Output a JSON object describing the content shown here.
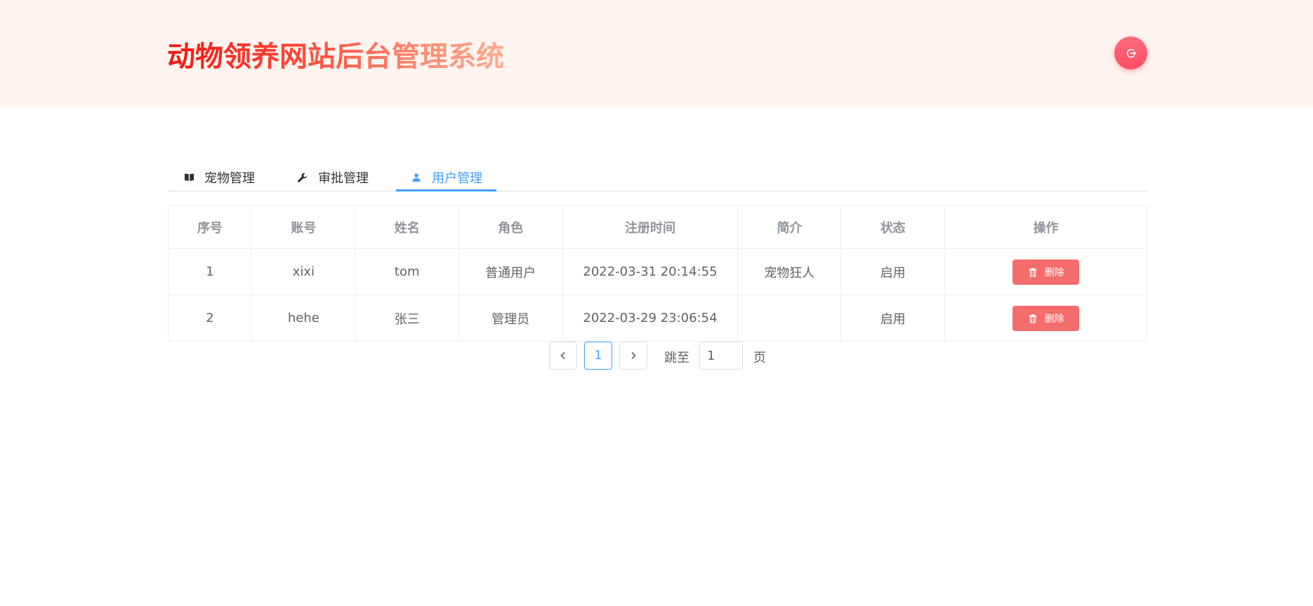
{
  "header": {
    "title": "动物领养网站后台管理系统",
    "logout_icon": "logout-icon"
  },
  "tabs": [
    {
      "label": "宠物管理",
      "icon": "book-icon",
      "active": false
    },
    {
      "label": "审批管理",
      "icon": "wrench-icon",
      "active": false
    },
    {
      "label": "用户管理",
      "icon": "user-icon",
      "active": true
    }
  ],
  "table": {
    "headers": [
      "序号",
      "账号",
      "姓名",
      "角色",
      "注册时间",
      "简介",
      "状态",
      "操作"
    ],
    "rows": [
      {
        "index": "1",
        "account": "xixi",
        "name": "tom",
        "role": "普通用户",
        "registered": "2022-03-31 20:14:55",
        "intro": "宠物狂人",
        "status": "启用",
        "action": "删除"
      },
      {
        "index": "2",
        "account": "hehe",
        "name": "张三",
        "role": "管理员",
        "registered": "2022-03-29 23:06:54",
        "intro": "",
        "status": "启用",
        "action": "删除"
      }
    ]
  },
  "pagination": {
    "current_page": "1",
    "jump_label": "跳至",
    "jump_value": "1",
    "page_suffix": "页"
  },
  "colors": {
    "accent": "#409eff",
    "danger": "#f56c6c",
    "status_on": "#0a9a1a",
    "header_bg": "#fff4ef"
  }
}
